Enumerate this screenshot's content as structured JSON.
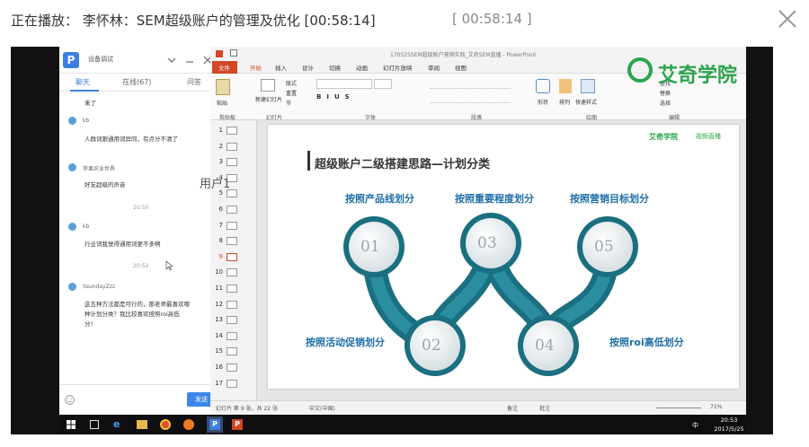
{
  "header": {
    "title": "正在播放： 李怀林：SEM超级账户的管理及优化 [00:58:14]",
    "time": "[ 00:58:14 ]"
  },
  "chat": {
    "app_title": "设备调试",
    "tabs": [
      "聊天",
      "在线(67)",
      "问答"
    ],
    "messages": [
      {
        "text": "来了"
      },
      {
        "name": "kb",
        "text": "人群词跟通用词异同，有点分不清了"
      },
      {
        "name": "苹果农业世界",
        "text": "好友超级的声音"
      },
      {
        "time": "20:50"
      },
      {
        "name": "kb",
        "text": "行业词我觉得通用词更不多啊"
      },
      {
        "time": "20:52"
      },
      {
        "name": "SsundayZzz",
        "text": "这五种方法都是可行的，那老师最喜欢哪种计划分类？我比较喜欢按照roi高低分！"
      }
    ],
    "send_label": "发送"
  },
  "overlay": {
    "user_label": "用户1"
  },
  "brand": {
    "name": "艾奇学院"
  },
  "ppt": {
    "window_title": "170525SEM超级账户营销实践_艾奇SEM直播 - PowerPoint",
    "menu_tabs": [
      "文件",
      "开始",
      "插入",
      "设计",
      "切换",
      "动画",
      "幻灯片放映",
      "审阅",
      "视图"
    ],
    "ribbon_groups": [
      "剪贴板",
      "幻灯片",
      "字体",
      "段落",
      "绘图",
      "编辑"
    ],
    "ribbon_buttons": [
      "粘贴",
      "新建幻灯片",
      "版式",
      "重置",
      "节",
      "形状",
      "排列",
      "快速样式",
      "查找",
      "替换",
      "选择"
    ],
    "thumb_numbers": [
      "1",
      "2",
      "3",
      "4",
      "5",
      "6",
      "7",
      "8",
      "9",
      "10",
      "11",
      "12",
      "13",
      "14",
      "15",
      "16",
      "17"
    ],
    "status": {
      "left": "幻灯片 第 9 张，共 22 张",
      "lang": "中文(中国)",
      "notes": "备注",
      "comments": "批注",
      "zoom": "71%"
    }
  },
  "slide": {
    "title": "超级账户二级搭建思路—计划分类",
    "logo_left": "艾奇学院",
    "logo_right": "视频直播",
    "labels": [
      "按照产品线划分",
      "按照重要程度划分",
      "按照营销目标划分",
      "按照活动促销划分",
      "按照roi高低划分"
    ],
    "circles": [
      "01",
      "02",
      "03",
      "04",
      "05"
    ]
  },
  "taskbar": {
    "time": "20:53",
    "date": "2017/5/25",
    "ime": "中"
  },
  "colors": {
    "teal": "#1f7a8c",
    "teal_dark": "#0f5a6a",
    "label": "#1f6fa8",
    "ppt_accent": "#d24726",
    "brand_green": "#2aa44a"
  }
}
